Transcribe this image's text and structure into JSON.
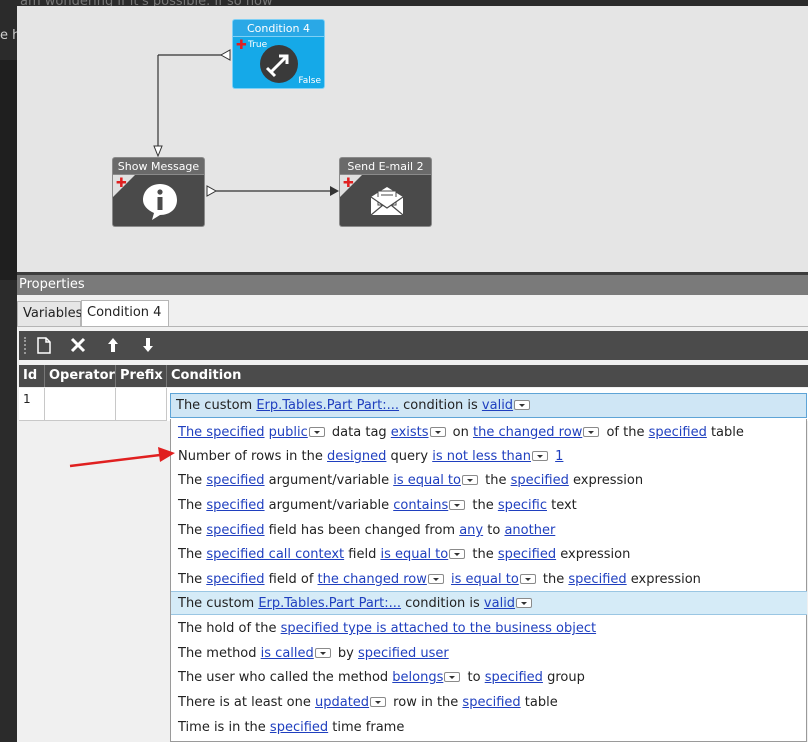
{
  "background": {
    "top_text": "am wondering if it's possible. If so how",
    "left_text": "e h"
  },
  "canvas": {
    "nodes": {
      "condition": {
        "title": "Condition 4",
        "true_label": "True",
        "false_label": "False"
      },
      "show_message": {
        "title": "Show Message 0"
      },
      "send_email": {
        "title": "Send E-mail 2"
      }
    }
  },
  "properties": {
    "header": "Properties",
    "tabs": [
      {
        "label": "Variables"
      },
      {
        "label": "Condition 4"
      }
    ],
    "grid": {
      "columns": [
        "Id",
        "Operator",
        "Prefix",
        "Condition"
      ],
      "row": {
        "id": "1",
        "operator": "",
        "prefix": ""
      }
    },
    "selected": {
      "p1": "The custom ",
      "l1": "Erp.Tables.Part Part:...",
      "p2": " condition is ",
      "l2": "valid"
    },
    "options": [
      {
        "p1": "",
        "l1": "The specified",
        "p2": " ",
        "l2": "public",
        "p3": " data tag ",
        "l3": "exists",
        "p4": " on ",
        "l4": "the changed row",
        "p5": " of the ",
        "l5": "specified",
        "p6": " table"
      },
      {
        "p1": "Number of rows in the ",
        "l1": "designed",
        "p2": " query ",
        "l2": "is not less than",
        "p3": " ",
        "l3": "1"
      },
      {
        "p1": "The ",
        "l1": "specified",
        "p2": " argument/variable ",
        "l2": "is equal to",
        "p3": " the ",
        "l3": "specified",
        "p4": " expression"
      },
      {
        "p1": "The ",
        "l1": "specified",
        "p2": " argument/variable ",
        "l2": "contains",
        "p3": " the ",
        "l3": "specific",
        "p4": " text"
      },
      {
        "p1": "The ",
        "l1": "specified",
        "p2": " field has been changed from ",
        "l2": "any",
        "p3": " to ",
        "l3": "another"
      },
      {
        "p1": "The ",
        "l1": "specified call context",
        "p2": " field ",
        "l2": "is equal to",
        "p3": " the ",
        "l3": "specified",
        "p4": " expression"
      },
      {
        "p1": "The ",
        "l1": "specified",
        "p2": " field of ",
        "l2": "the changed row",
        "p3": " ",
        "l3": "is equal to",
        "p4": " the ",
        "l4": "specified",
        "p5": " expression"
      },
      {
        "p1": "The custom ",
        "l1": "Erp.Tables.Part Part:...",
        "p2": " condition is ",
        "l2": "valid"
      },
      {
        "p1": "The hold of the ",
        "l1": "specified type is attached to the business object"
      },
      {
        "p1": "The method ",
        "l1": "is called",
        "p2": " by ",
        "l2": "specified user"
      },
      {
        "p1": "The user who called the method ",
        "l1": "belongs",
        "p2": " to ",
        "l2": "specified",
        "p3": " group"
      },
      {
        "p1": "There is at least one ",
        "l1": "updated",
        "p2": " row in the ",
        "l2": "specified",
        "p3": " table"
      },
      {
        "p1": "Time is in the ",
        "l1": "specified",
        "p2": " time frame"
      }
    ]
  },
  "colors": {
    "accent_blue": "#15a9e8",
    "link": "#1f3fbf",
    "highlight": "#d5ebf7",
    "arrow_red": "#e02020"
  }
}
